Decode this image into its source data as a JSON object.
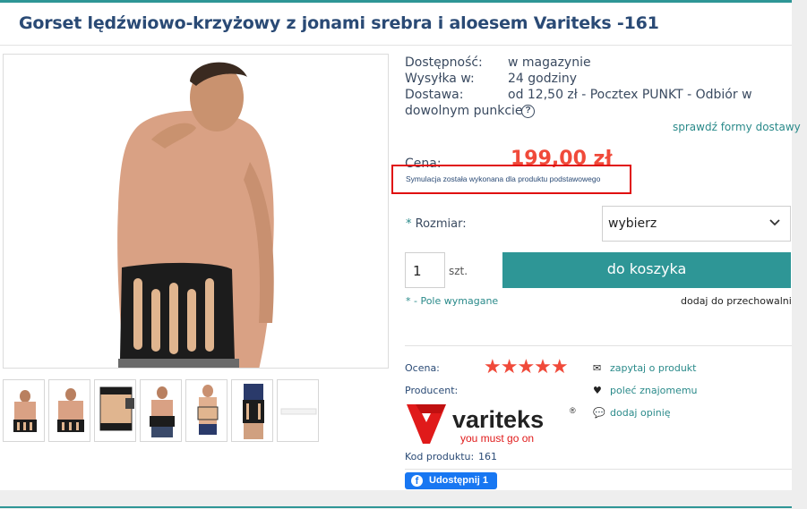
{
  "product": {
    "title": "Gorset lędźwiowo-krzyżowy z jonami srebra i aloesem Variteks -161"
  },
  "info": {
    "availability_label": "Dostępność:",
    "availability_value": "w magazynie",
    "shipping_label": "Wysyłka w:",
    "shipping_value": "24 godziny",
    "delivery_label": "Dostawa:",
    "delivery_value": "od 12,50 zł - Pocztex PUNKT - Odbiór w",
    "delivery_value_2": "dowolnym punkcie",
    "help_icon_glyph": "?",
    "shipping_forms_link": "sprawdź formy dostawy"
  },
  "price": {
    "label": "Cena:",
    "value": "199,00 zł",
    "simulation_note": "Symulacja została wykonana dla produktu podstawowego"
  },
  "size": {
    "star": "*",
    "label": "Rozmiar:",
    "selected": "wybierz",
    "chevron_icon": "chevron-down-icon"
  },
  "cart": {
    "quantity": "1",
    "unit": "szt.",
    "button_label": "do koszyka",
    "required_note": "* - Pole wymagane",
    "store_link": "dodaj do przechowalni"
  },
  "details": {
    "rating_label": "Ocena:",
    "rating_stars": "★★★★★",
    "rating_value": 5,
    "rating_max": 5,
    "producer_label": "Producent:",
    "code_label": "Kod produktu:",
    "code_value": "161"
  },
  "brand": {
    "name": "variteks",
    "registered": "®",
    "tagline": "you must go on"
  },
  "actions": [
    {
      "label": "zapytaj o produkt",
      "icon": "envelope-icon",
      "glyph": "✉"
    },
    {
      "label": "poleć znajomemu",
      "icon": "heart-icon",
      "glyph": "♥"
    },
    {
      "label": "dodaj opinię",
      "icon": "comments-icon",
      "glyph": "💬"
    }
  ],
  "share": {
    "label": "Udostępnij 1",
    "icon_glyph": "f"
  },
  "colors": {
    "accent": "#2e9696",
    "price": "#f04a3a",
    "title": "#2a4a75",
    "highlight_box": "#e01010",
    "facebook": "#1877f2"
  }
}
